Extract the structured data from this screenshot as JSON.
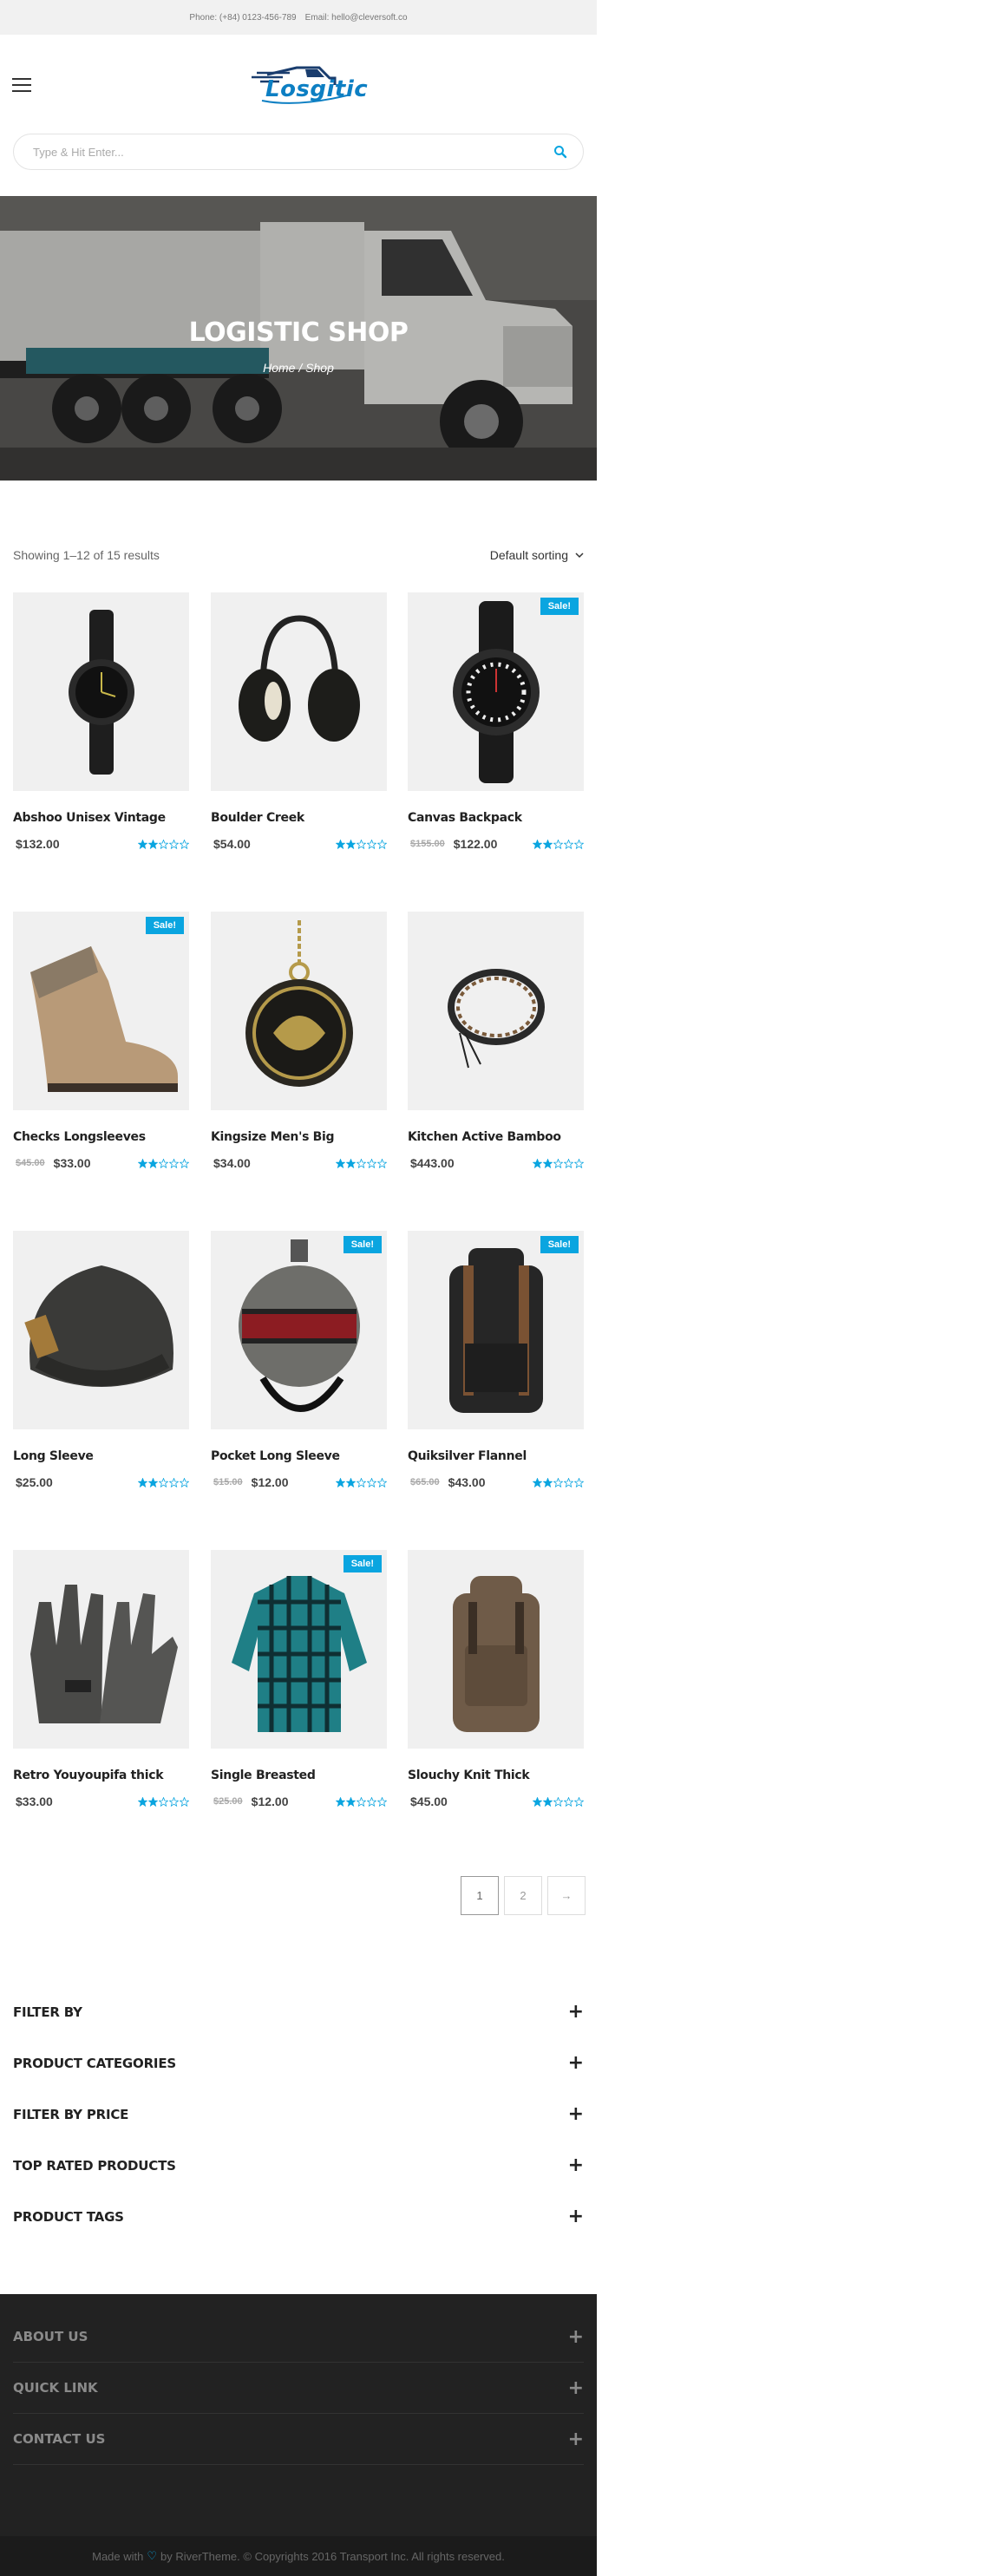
{
  "topbar": {
    "phone": "Phone: (+84) 0123-456-789",
    "email": "Email: hello@cleversoft.co"
  },
  "header": {
    "logo_text": "Losgitic",
    "brand_color": "#0d7fc3"
  },
  "search": {
    "placeholder": "Type & Hit Enter..."
  },
  "hero": {
    "title": "LOGISTIC SHOP",
    "crumb_home": "Home",
    "crumb_sep": " / ",
    "crumb_current": "Shop"
  },
  "toolbar": {
    "result_count": "Showing 1–12 of 15 results",
    "sorting": "Default sorting"
  },
  "accent_color": "#0aa5e0",
  "products": [
    {
      "name": "Abshoo Unisex Vintage",
      "price": "$132.00",
      "old_price": "",
      "sale": "",
      "rating": 2,
      "image": "wristwatch"
    },
    {
      "name": "Boulder Creek",
      "price": "$54.00",
      "old_price": "",
      "sale": "",
      "rating": 2,
      "image": "earmuffs"
    },
    {
      "name": "Canvas Backpack",
      "price": "$122.00",
      "old_price": "$155.00",
      "sale": "Sale!",
      "rating": 2,
      "image": "sport-watch"
    },
    {
      "name": "Checks Longsleeves",
      "price": "$33.00",
      "old_price": "$45.00",
      "sale": "Sale!",
      "rating": 2,
      "image": "boot"
    },
    {
      "name": "Kingsize Men's Big",
      "price": "$34.00",
      "old_price": "",
      "sale": "",
      "rating": 2,
      "image": "pocket-watch"
    },
    {
      "name": "Kitchen Active Bamboo",
      "price": "$443.00",
      "old_price": "",
      "sale": "",
      "rating": 2,
      "image": "bracelet"
    },
    {
      "name": "Long Sleeve",
      "price": "$25.00",
      "old_price": "",
      "sale": "",
      "rating": 2,
      "image": "beanie"
    },
    {
      "name": "Pocket Long Sleeve",
      "price": "$12.00",
      "old_price": "$15.00",
      "sale": "Sale!",
      "rating": 2,
      "image": "flask"
    },
    {
      "name": "Quiksilver Flannel",
      "price": "$43.00",
      "old_price": "$65.00",
      "sale": "Sale!",
      "rating": 2,
      "image": "backpack-dark"
    },
    {
      "name": "Retro Youyoupifa thick",
      "price": "$33.00",
      "old_price": "",
      "sale": "",
      "rating": 2,
      "image": "gloves"
    },
    {
      "name": "Single Breasted",
      "price": "$12.00",
      "old_price": "$25.00",
      "sale": "Sale!",
      "rating": 2,
      "image": "flannel-shirt"
    },
    {
      "name": "Slouchy Knit Thick",
      "price": "$45.00",
      "old_price": "",
      "sale": "",
      "rating": 2,
      "image": "backpack-brown"
    }
  ],
  "pagination": {
    "pages": [
      "1",
      "2"
    ],
    "next": "→"
  },
  "widgets": [
    "FILTER BY",
    "PRODUCT CATEGORIES",
    "FILTER BY PRICE",
    "TOP RATED PRODUCTS",
    "PRODUCT TAGS"
  ],
  "footer": {
    "widgets": [
      "ABOUT US",
      "QUICK LINK",
      "CONTACT US"
    ],
    "made_with": "Made with",
    "by": "by RiverTheme. © Copyrights 2016 Transport Inc. All rights reserved."
  }
}
